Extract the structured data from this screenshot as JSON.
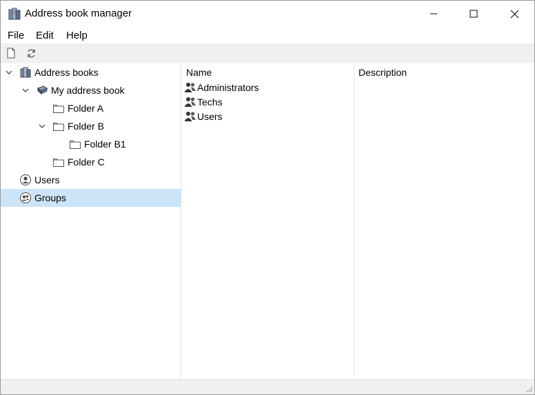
{
  "window": {
    "title": "Address book manager",
    "icon": "address-books-icon",
    "controls": [
      "minimize-icon",
      "maximize-icon",
      "close-icon"
    ]
  },
  "menu": {
    "file": "File",
    "edit": "Edit",
    "help": "Help"
  },
  "toolbar": {
    "buttons": [
      "new-document-icon",
      "refresh-icon"
    ]
  },
  "tree": {
    "root": "Address books",
    "book": "My address book",
    "folder_a": "Folder A",
    "folder_b": "Folder B",
    "folder_b1": "Folder B1",
    "folder_c": "Folder C",
    "users": "Users",
    "groups": "Groups",
    "selected": "Groups"
  },
  "list": {
    "columns": [
      "Name",
      "Description"
    ],
    "rows": [
      {
        "name": "Administrators",
        "description": ""
      },
      {
        "name": "Techs",
        "description": ""
      },
      {
        "name": "Users",
        "description": ""
      }
    ]
  },
  "colors": {
    "selection": "#cce4f7",
    "toolbar_bg": "#f0f0f0"
  }
}
